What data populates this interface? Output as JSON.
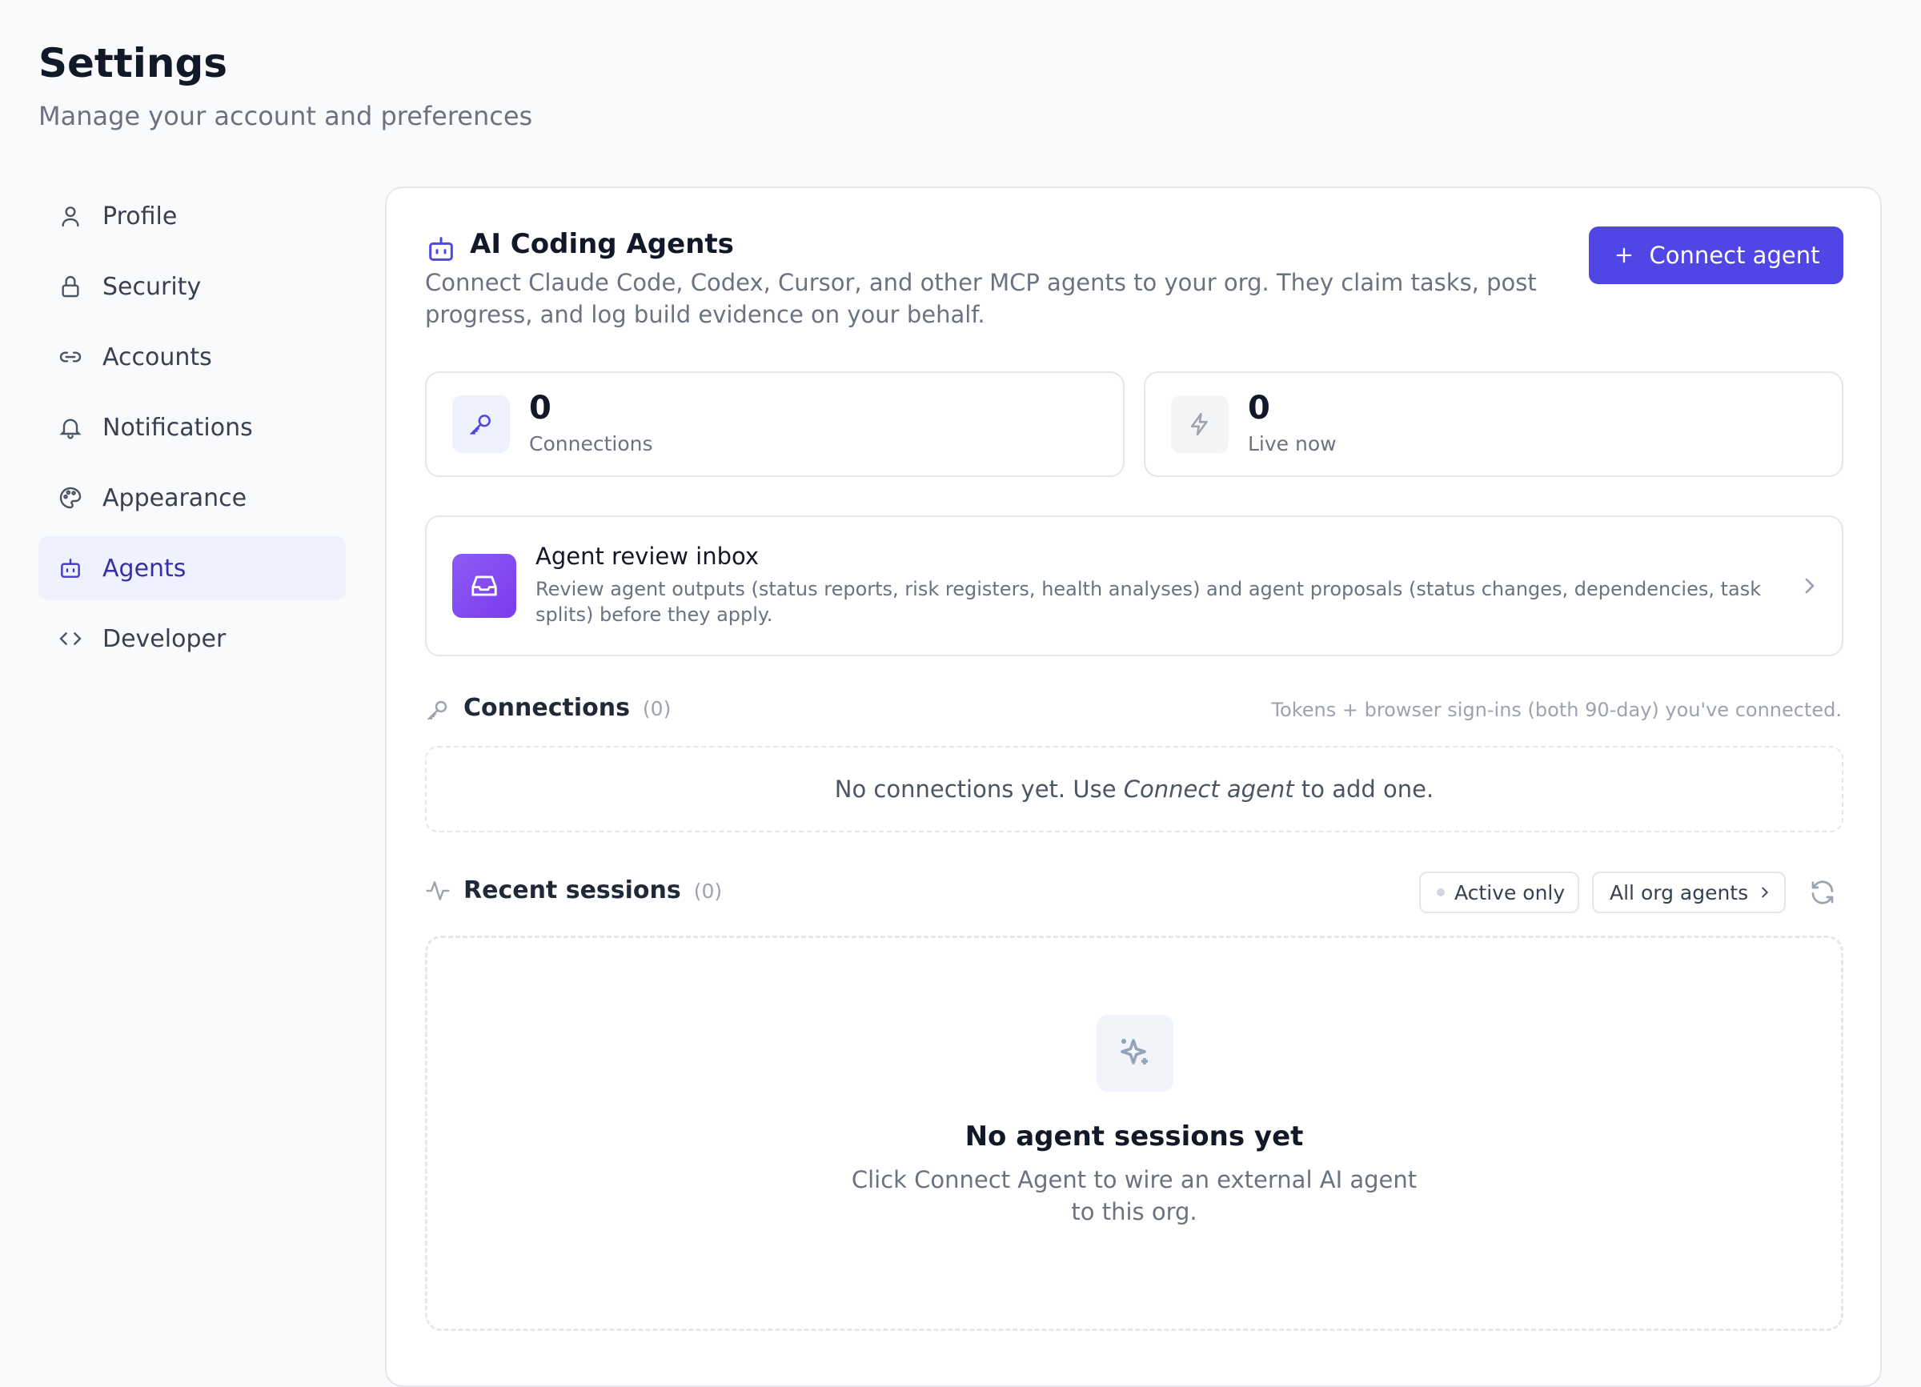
{
  "header": {
    "title": "Settings",
    "subtitle": "Manage your account and preferences"
  },
  "sidebar": {
    "items": [
      {
        "label": "Profile",
        "icon": "user-icon",
        "active": false
      },
      {
        "label": "Security",
        "icon": "lock-icon",
        "active": false
      },
      {
        "label": "Accounts",
        "icon": "link-icon",
        "active": false
      },
      {
        "label": "Notifications",
        "icon": "bell-icon",
        "active": false
      },
      {
        "label": "Appearance",
        "icon": "palette-icon",
        "active": false
      },
      {
        "label": "Agents",
        "icon": "bot-icon",
        "active": true
      },
      {
        "label": "Developer",
        "icon": "code-icon",
        "active": false
      }
    ]
  },
  "agents": {
    "title": "AI Coding Agents",
    "description": "Connect Claude Code, Codex, Cursor, and other MCP agents to your org. They claim tasks, post progress, and log build evidence on your behalf.",
    "connect_button": "Connect agent",
    "stats": {
      "connections": {
        "value": "0",
        "label": "Connections"
      },
      "live": {
        "value": "0",
        "label": "Live now"
      }
    },
    "inbox": {
      "title": "Agent review inbox",
      "description": "Review agent outputs (status reports, risk registers, health analyses) and agent proposals (status changes, dependencies, task splits) before they apply."
    },
    "connections": {
      "title": "Connections",
      "count": "(0)",
      "hint": "Tokens + browser sign-ins (both 90-day) you've connected.",
      "empty_prefix": "No connections yet. Use ",
      "empty_em": "Connect agent",
      "empty_suffix": " to add one."
    },
    "sessions": {
      "title": "Recent sessions",
      "count": "(0)",
      "filter_active": "Active only",
      "filter_scope": "All org agents",
      "empty_title": "No agent sessions yet",
      "empty_desc": "Click Connect Agent to wire an external AI agent to this org."
    }
  },
  "colors": {
    "accent": "#4f46e5",
    "active_bg": "#eef2ff",
    "active_text": "#3730a3"
  }
}
